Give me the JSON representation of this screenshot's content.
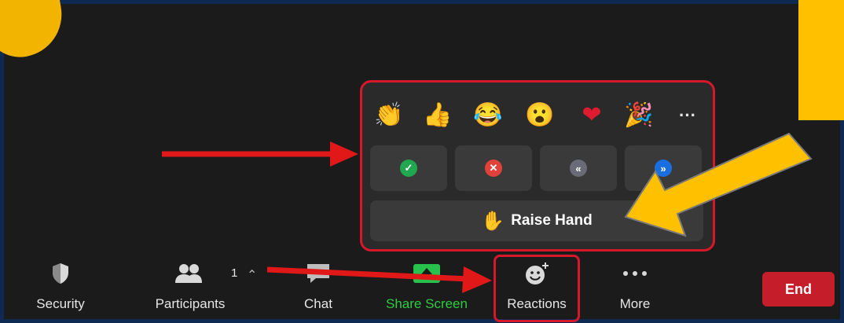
{
  "colors": {
    "annotation_red": "#d6182a",
    "annotation_yellow": "#ffc000",
    "end_red": "#c61d2a",
    "share_green": "#2ecc40"
  },
  "reactions_popup": {
    "emojis": [
      {
        "name": "clapping-hands-icon",
        "glyph": "👏"
      },
      {
        "name": "thumbs-up-icon",
        "glyph": "👍"
      },
      {
        "name": "tears-of-joy-icon",
        "glyph": "😂"
      },
      {
        "name": "surprised-face-icon",
        "glyph": "😮"
      },
      {
        "name": "heart-icon",
        "glyph": "❤"
      },
      {
        "name": "party-popper-icon",
        "glyph": "🎉"
      }
    ],
    "more_glyph": "···",
    "feedback": [
      {
        "name": "yes-button",
        "icon": "check-icon",
        "glyph": "✓",
        "color": "#1fa84f"
      },
      {
        "name": "no-button",
        "icon": "x-icon",
        "glyph": "✕",
        "color": "#e0423a"
      },
      {
        "name": "go-slower-button",
        "icon": "rewind-icon",
        "glyph": "«",
        "color": "#6b6b78"
      },
      {
        "name": "go-faster-button",
        "icon": "fast-forward-icon",
        "glyph": "»",
        "color": "#1a6fe0"
      }
    ],
    "raise_hand_label": "Raise Hand",
    "raise_hand_glyph": "✋"
  },
  "toolbar": {
    "security_label": "Security",
    "participants_label": "Participants",
    "participants_count": "1",
    "chat_label": "Chat",
    "share_label": "Share Screen",
    "reactions_label": "Reactions",
    "more_label": "More",
    "end_label": "End"
  }
}
